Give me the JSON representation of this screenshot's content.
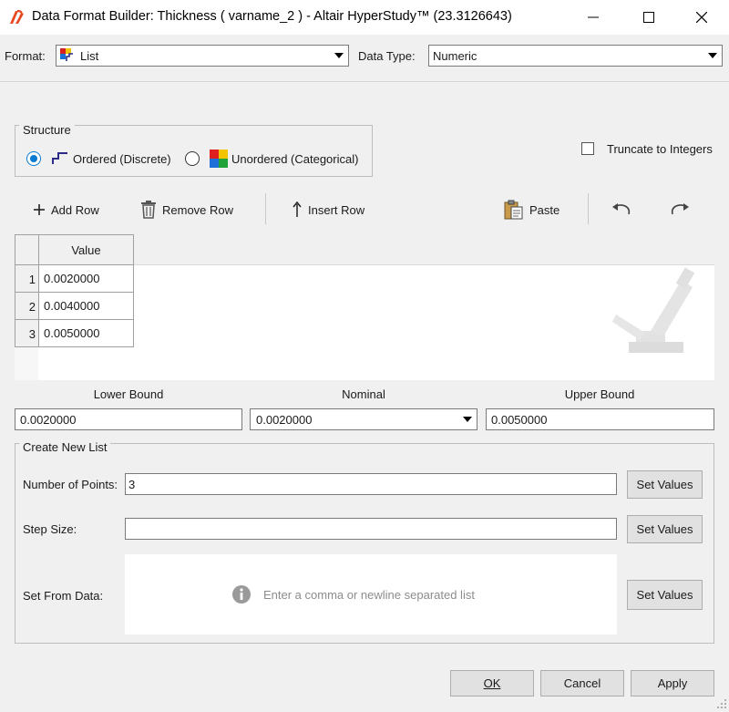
{
  "window": {
    "title": "Data Format Builder: Thickness ( varname_2 ) - Altair HyperStudy™ (23.3126643)"
  },
  "format": {
    "label": "Format:",
    "value": "List",
    "data_type_label": "Data Type:",
    "data_type_value": "Numeric"
  },
  "structure": {
    "title": "Structure",
    "ordered_label": "Ordered (Discrete)",
    "unordered_label": "Unordered (Categorical)",
    "truncate_label": "Truncate to Integers"
  },
  "toolbar": {
    "add_row": "Add Row",
    "remove_row": "Remove Row",
    "insert_row": "Insert Row",
    "paste": "Paste"
  },
  "table": {
    "column": "Value",
    "rows": [
      {
        "index": "1",
        "value": "0.0020000"
      },
      {
        "index": "2",
        "value": "0.0040000"
      },
      {
        "index": "3",
        "value": "0.0050000"
      }
    ]
  },
  "bounds": {
    "lower_label": "Lower Bound",
    "nominal_label": "Nominal",
    "upper_label": "Upper Bound",
    "lower_value": "0.0020000",
    "nominal_value": "0.0020000",
    "upper_value": "0.0050000"
  },
  "create_list": {
    "title": "Create New List",
    "points_label": "Number of Points:",
    "points_value": "3",
    "step_label": "Step Size:",
    "step_value": "",
    "from_data_label": "Set From Data:",
    "from_data_placeholder": "Enter a comma or newline separated list",
    "set_values": "Set Values"
  },
  "footer": {
    "ok": "OK",
    "cancel": "Cancel",
    "apply": "Apply"
  }
}
